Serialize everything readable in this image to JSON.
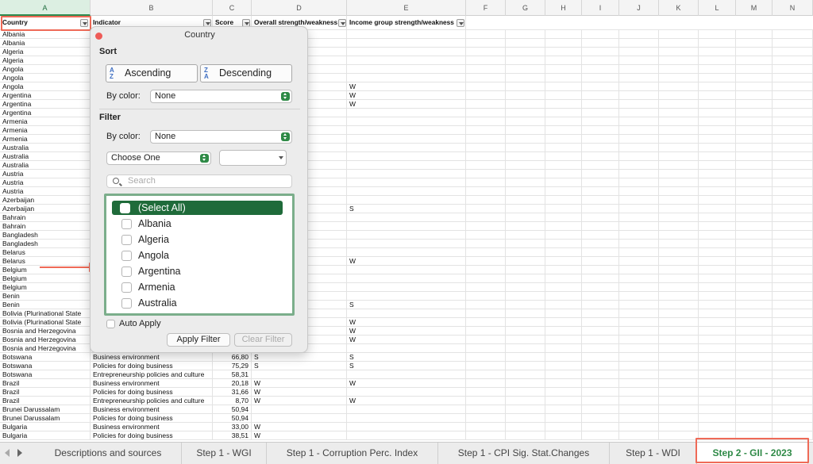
{
  "columns": [
    "A",
    "B",
    "C",
    "D",
    "E",
    "F",
    "G",
    "H",
    "I",
    "J",
    "K",
    "L",
    "M",
    "N"
  ],
  "headers": {
    "country": "Country",
    "indicator": "Indicator",
    "score": "Score",
    "overall": "Overall strength/weakness",
    "income": "Income group strength/weakness"
  },
  "rows": [
    {
      "a": "Albania",
      "b": "",
      "c": "",
      "d": "",
      "e": ""
    },
    {
      "a": "Albania",
      "b": "",
      "c": "",
      "d": "",
      "e": ""
    },
    {
      "a": "Algeria",
      "b": "",
      "c": "",
      "d": "",
      "e": ""
    },
    {
      "a": "Algeria",
      "b": "",
      "c": "",
      "d": "",
      "e": ""
    },
    {
      "a": "Angola",
      "b": "",
      "c": "",
      "d": "",
      "e": ""
    },
    {
      "a": "Angola",
      "b": "",
      "c": "",
      "d": "",
      "e": ""
    },
    {
      "a": "Angola",
      "b": "",
      "c": "",
      "d": "",
      "e": "W"
    },
    {
      "a": "Argentina",
      "b": "",
      "c": "",
      "d": "",
      "e": "W"
    },
    {
      "a": "Argentina",
      "b": "",
      "c": "",
      "d": "",
      "e": "W"
    },
    {
      "a": "Argentina",
      "b": "",
      "c": "",
      "d": "",
      "e": ""
    },
    {
      "a": "Armenia",
      "b": "",
      "c": "",
      "d": "",
      "e": ""
    },
    {
      "a": "Armenia",
      "b": "",
      "c": "",
      "d": "",
      "e": ""
    },
    {
      "a": "Armenia",
      "b": "",
      "c": "",
      "d": "",
      "e": ""
    },
    {
      "a": "Australia",
      "b": "",
      "c": "",
      "d": "",
      "e": ""
    },
    {
      "a": "Australia",
      "b": "",
      "c": "",
      "d": "",
      "e": ""
    },
    {
      "a": "Australia",
      "b": "",
      "c": "",
      "d": "",
      "e": ""
    },
    {
      "a": "Austria",
      "b": "",
      "c": "",
      "d": "",
      "e": ""
    },
    {
      "a": "Austria",
      "b": "",
      "c": "",
      "d": "",
      "e": ""
    },
    {
      "a": "Austria",
      "b": "",
      "c": "",
      "d": "",
      "e": ""
    },
    {
      "a": "Azerbaijan",
      "b": "",
      "c": "",
      "d": "",
      "e": ""
    },
    {
      "a": "Azerbaijan",
      "b": "",
      "c": "",
      "d": "",
      "e": "S"
    },
    {
      "a": "Bahrain",
      "b": "",
      "c": "",
      "d": "",
      "e": ""
    },
    {
      "a": "Bahrain",
      "b": "",
      "c": "",
      "d": "",
      "e": ""
    },
    {
      "a": "Bangladesh",
      "b": "",
      "c": "",
      "d": "",
      "e": ""
    },
    {
      "a": "Bangladesh",
      "b": "",
      "c": "",
      "d": "",
      "e": ""
    },
    {
      "a": "Belarus",
      "b": "",
      "c": "",
      "d": "",
      "e": ""
    },
    {
      "a": "Belarus",
      "b": "",
      "c": "",
      "d": "",
      "e": "W"
    },
    {
      "a": "Belgium",
      "b": "",
      "c": "",
      "d": "",
      "e": ""
    },
    {
      "a": "Belgium",
      "b": "",
      "c": "",
      "d": "",
      "e": ""
    },
    {
      "a": "Belgium",
      "b": "",
      "c": "",
      "d": "",
      "e": ""
    },
    {
      "a": "Benin",
      "b": "",
      "c": "",
      "d": "",
      "e": ""
    },
    {
      "a": "Benin",
      "b": "",
      "c": "",
      "d": "",
      "e": "S"
    },
    {
      "a": "Bolivia (Plurinational State",
      "b": "",
      "c": "",
      "d": "",
      "e": ""
    },
    {
      "a": "Bolivia (Plurinational State",
      "b": "",
      "c": "",
      "d": "",
      "e": "W"
    },
    {
      "a": "Bosnia and Herzegovina",
      "b": "",
      "c": "",
      "d": "",
      "e": "W"
    },
    {
      "a": "Bosnia and Herzegovina",
      "b": "",
      "c": "",
      "d": "",
      "e": "W"
    },
    {
      "a": "Bosnia and Herzegovina",
      "b": "",
      "c": "",
      "d": "",
      "e": ""
    },
    {
      "a": "Botswana",
      "b": "Business environment",
      "c": "66,80",
      "d": "S",
      "e": "S"
    },
    {
      "a": "Botswana",
      "b": "Policies for doing business",
      "c": "75,29",
      "d": "S",
      "e": "S"
    },
    {
      "a": "Botswana",
      "b": "Entrepreneurship policies and culture",
      "c": "58,31",
      "d": "",
      "e": ""
    },
    {
      "a": "Brazil",
      "b": "Business environment",
      "c": "20,18",
      "d": "W",
      "e": "W"
    },
    {
      "a": "Brazil",
      "b": "Policies for doing business",
      "c": "31,66",
      "d": "W",
      "e": ""
    },
    {
      "a": "Brazil",
      "b": "Entrepreneurship policies and culture",
      "c": "8,70",
      "d": "W",
      "e": "W"
    },
    {
      "a": "Brunei Darussalam",
      "b": "Business environment",
      "c": "50,94",
      "d": "",
      "e": ""
    },
    {
      "a": "Brunei Darussalam",
      "b": "Policies for doing business",
      "c": "50,94",
      "d": "",
      "e": ""
    },
    {
      "a": "Bulgaria",
      "b": "Business environment",
      "c": "33,00",
      "d": "W",
      "e": ""
    },
    {
      "a": "Bulgaria",
      "b": "Policies for doing business",
      "c": "38,51",
      "d": "W",
      "e": ""
    }
  ],
  "popover": {
    "title": "Country",
    "sort_label": "Sort",
    "ascending": "Ascending",
    "descending": "Descending",
    "az_top": "A",
    "az_bottom": "Z",
    "za_top": "Z",
    "za_bottom": "A",
    "sort_by_color_label": "By color:",
    "sort_by_color_value": "None",
    "filter_label": "Filter",
    "filter_by_color_label": "By color:",
    "filter_by_color_value": "None",
    "choose_one": "Choose One",
    "search_placeholder": "Search",
    "items": [
      "(Select All)",
      "Albania",
      "Algeria",
      "Angola",
      "Argentina",
      "Armenia",
      "Australia"
    ],
    "auto_apply": "Auto Apply",
    "apply_filter": "Apply Filter",
    "clear_filter": "Clear Filter"
  },
  "tabs": [
    "Descriptions and sources",
    "Step 1 - WGI",
    "Step 1 - Corruption Perc. Index",
    "Step 1 - CPI Sig. Stat.Changes",
    "Step 1 - WDI",
    "Step 2 - GII - 2023"
  ],
  "colors": {
    "accent": "#1f6b3a",
    "highlight": "#ef6a57",
    "active_tab": "#2f8a47"
  }
}
